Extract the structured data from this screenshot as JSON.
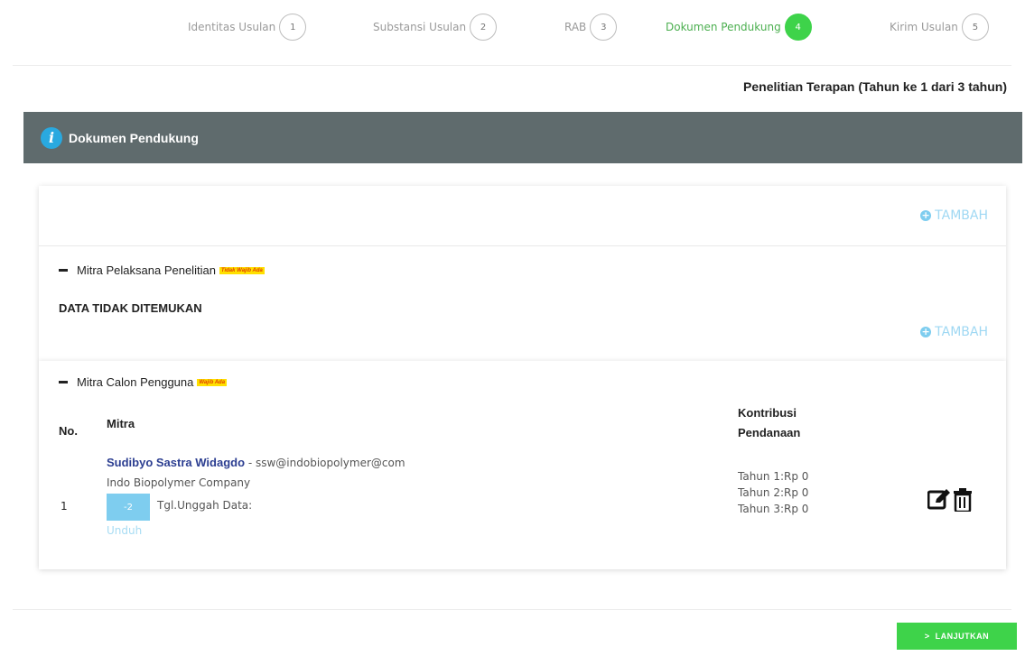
{
  "stepper": {
    "steps": [
      {
        "label": "Identitas Usulan",
        "num": "1",
        "active": false
      },
      {
        "label": "Substansi Usulan",
        "num": "2",
        "active": false
      },
      {
        "label": "RAB",
        "num": "3",
        "active": false
      },
      {
        "label": "Dokumen Pendukung",
        "num": "4",
        "active": true
      },
      {
        "label": "Kirim Usulan",
        "num": "5",
        "active": false
      }
    ]
  },
  "scheme": "Penelitian Terapan (Tahun ke 1 dari 3 tahun)",
  "panel": {
    "title": "Dokumen Pendukung",
    "info_icon": "i"
  },
  "tambah_label": "TAMBAH",
  "section1": {
    "title": "Mitra Pelaksana Penelitian",
    "badge": "Tidak Wajib Ada",
    "empty_text": "DATA TIDAK DITEMUKAN"
  },
  "section2": {
    "title": "Mitra Calon Pengguna",
    "badge": "Wajib Ada",
    "headers": {
      "no": "No.",
      "mitra": "Mitra",
      "kontribusi_1": "Kontribusi",
      "kontribusi_2": "Pendanaan"
    },
    "row": {
      "no": "1",
      "name": "Sudibyo Sastra Widagdo",
      "email": "- ssw@indobiopolymer@com",
      "company": "Indo Biopolymer Company",
      "doc_icon_text": "-2",
      "upload_date_label": "Tgl.Unggah Data:",
      "download_label": "Unduh",
      "tahun": [
        "Tahun 1:Rp 0",
        "Tahun 2:Rp 0",
        "Tahun 3:Rp 0"
      ]
    }
  },
  "buttons": {
    "lanjutkan": "LANJUTKAN",
    "lanjutkan_icon": ">"
  },
  "colors": {
    "accent_green": "#3ed34a",
    "header_gray": "#5f6b6d",
    "link_blue": "#2c3e91",
    "light_blue": "#7ecdef"
  }
}
